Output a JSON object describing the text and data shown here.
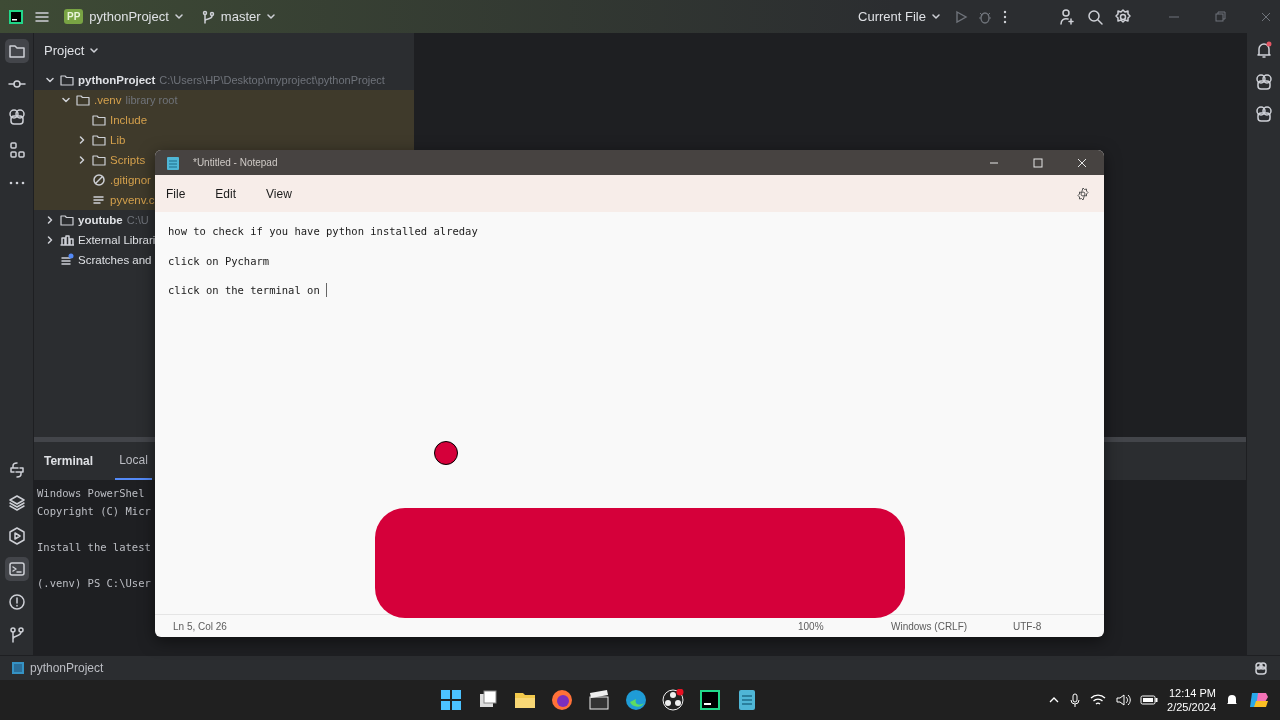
{
  "titlebar": {
    "project": {
      "badge": "PP",
      "label": "pythonProject"
    },
    "branch": "master",
    "run_config": "Current File"
  },
  "left_strip": {
    "top": [
      {
        "kind": "folder",
        "selected": true
      },
      {
        "kind": "commit",
        "selected": false
      },
      {
        "kind": "assistant",
        "selected": false
      },
      {
        "kind": "structure",
        "selected": false
      },
      {
        "kind": "more",
        "selected": false
      }
    ],
    "bottom": [
      {
        "kind": "python",
        "selected": false
      },
      {
        "kind": "layers",
        "selected": false
      },
      {
        "kind": "play",
        "selected": false
      },
      {
        "kind": "terminal",
        "selected": true
      },
      {
        "kind": "problems",
        "selected": false
      },
      {
        "kind": "git",
        "selected": false
      }
    ]
  },
  "right_strip": [
    {
      "kind": "bell"
    },
    {
      "kind": "assistant"
    },
    {
      "kind": "assistant"
    }
  ],
  "project_panel": {
    "title": "Project",
    "tree": [
      {
        "label": "pythonProject",
        "hint": "C:\\Users\\HP\\Desktop\\myproject\\pythonProject",
        "kind": "folder",
        "expanded": true,
        "highlighted": false,
        "children": [
          {
            "label": ".venv",
            "hint": "library root",
            "kind": "folder",
            "expanded": true,
            "highlighted": true,
            "children": [
              {
                "label": "Include",
                "kind": "folder",
                "highlighted": true
              },
              {
                "label": "Lib",
                "kind": "folder",
                "expanded": false,
                "highlighted": true
              },
              {
                "label": "Scripts",
                "kind": "folder",
                "expanded": false,
                "highlighted": true
              },
              {
                "label": ".gitignor",
                "kind": "ignore",
                "highlighted": true
              },
              {
                "label": "pyvenv.c",
                "kind": "file",
                "highlighted": true
              }
            ]
          }
        ]
      },
      {
        "label": "youtube",
        "hint": "C:\\U",
        "kind": "folder",
        "expanded": false,
        "highlighted": false
      },
      {
        "label": "External Librari",
        "kind": "library",
        "expanded": false,
        "highlighted": false
      },
      {
        "label": "Scratches and",
        "kind": "scratch",
        "highlighted": false
      }
    ]
  },
  "terminal": {
    "title": "Terminal",
    "tabs": [
      {
        "label": "Local",
        "selected": true
      }
    ],
    "blocks": [
      [
        "Windows PowerShel",
        "Copyright (C) Micr"
      ],
      [
        "Install the latest"
      ],
      [
        "(.venv) PS C:\\User"
      ]
    ]
  },
  "status_bar": {
    "project": "pythonProject"
  },
  "notepad": {
    "title": "*Untitled - Notepad",
    "menu": [
      "File",
      "Edit",
      "View"
    ],
    "lines": [
      "how to check if you have python installed alreday",
      "click on Pycharm",
      "click on the terminal on "
    ],
    "status": [
      "Ln 5, Col 26",
      "100%",
      "Windows (CRLF)",
      "UTF-8"
    ]
  },
  "taskbar": {
    "apps": [
      {
        "kind": "windows"
      },
      {
        "kind": "taskview"
      },
      {
        "kind": "folder"
      },
      {
        "kind": "firefox"
      },
      {
        "kind": "clapper"
      },
      {
        "kind": "edge"
      },
      {
        "kind": "obs"
      },
      {
        "kind": "pycharm"
      },
      {
        "kind": "notepad"
      }
    ],
    "time": "12:14 PM",
    "date": "2/25/2024"
  }
}
